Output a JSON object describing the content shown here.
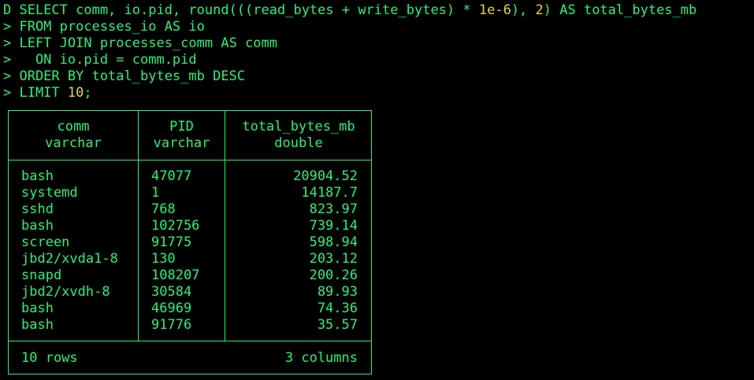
{
  "terminal": {
    "cut_line": "  ...   .  .",
    "prompt_line_1": {
      "prefix": "D SELECT comm, io.pid, round(((read_bytes + write_bytes) * ",
      "num1": "1e-6",
      "mid": "), ",
      "num2": "2",
      "suffix": ") AS total_bytes_mb"
    },
    "prompt_line_2": "> FROM processes_io AS io",
    "prompt_line_3": "> LEFT JOIN processes_comm AS comm",
    "prompt_line_4": ">   ON io.pid = comm.pid",
    "prompt_line_5": "> ORDER BY total_bytes_mb DESC",
    "prompt_line_6": {
      "prefix": "> LIMIT ",
      "num": "10",
      "suffix": ";"
    }
  },
  "table": {
    "columns": [
      {
        "name": "comm",
        "type": "varchar"
      },
      {
        "name": "PID",
        "type": "varchar"
      },
      {
        "name": "total_bytes_mb",
        "type": "double"
      }
    ],
    "rows": [
      [
        "bash",
        "47077",
        "20904.52"
      ],
      [
        "systemd",
        "1",
        "14187.7"
      ],
      [
        "sshd",
        "768",
        "823.97"
      ],
      [
        "bash",
        "102756",
        "739.14"
      ],
      [
        "screen",
        "91775",
        "598.94"
      ],
      [
        "jbd2/xvda1-8",
        "130",
        "203.12"
      ],
      [
        "snapd",
        "108207",
        "200.26"
      ],
      [
        "jbd2/xvdh-8",
        "30584",
        "89.93"
      ],
      [
        "bash",
        "46969",
        "74.36"
      ],
      [
        "bash",
        "91776",
        "35.57"
      ]
    ],
    "footer_rows": "10 rows",
    "footer_columns": "3 columns"
  },
  "colors": {
    "text": "#2bf07a",
    "number_literal": "#e5d34b",
    "background": "#000000"
  }
}
